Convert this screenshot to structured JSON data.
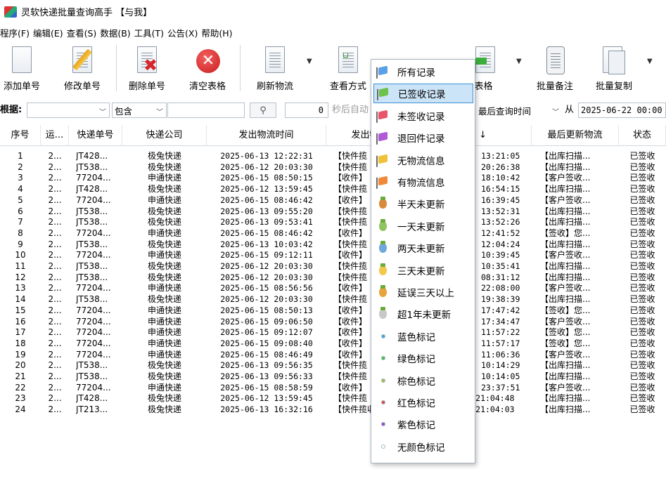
{
  "window": {
    "title": "灵软快递批量查询高手 【与我】"
  },
  "menu": [
    "程序(F)",
    "编辑(E)",
    "查看(S)",
    "数据(B)",
    "工具(T)",
    "公告(X)",
    "帮助(H)"
  ],
  "toolbar": {
    "add": "添加单号",
    "edit": "修改单号",
    "delete": "删除单号",
    "clear": "清空表格",
    "refresh": "刷新物流",
    "view_mode": "查看方式",
    "export": "出表格",
    "batch_note": "批量备注",
    "batch_copy": "批量复制"
  },
  "filter": {
    "label": "根据:",
    "field_value": "",
    "match_mode": "包含",
    "keyword": "",
    "interval": "0",
    "auto_label": "秒后自动",
    "time_field": "最后查询时间",
    "from_label": "从",
    "from_date": "2025-06-22 00:00"
  },
  "table": {
    "columns": [
      "序号",
      "运...",
      "快递单号",
      "快递公司",
      "发出物流时间",
      "发出物流",
      "时间 ↓",
      "最后更新物流",
      "状态"
    ],
    "rows": [
      [
        "1",
        "2...",
        "JT428...",
        "极兔快递",
        "2025-06-13 12:22:31",
        "【快件揽",
        "13:21:05",
        "【出库扫描...",
        "已签收"
      ],
      [
        "2",
        "2...",
        "JT538...",
        "极兔快递",
        "2025-06-12 20:03:30",
        "【快件揽",
        "20:26:38",
        "【出库扫描...",
        "已签收"
      ],
      [
        "3",
        "2...",
        "77204...",
        "申通快递",
        "2025-06-15 08:50:15",
        "【收件】",
        "18:10:42",
        "【客户签收...",
        "已签收"
      ],
      [
        "4",
        "2...",
        "JT428...",
        "极兔快递",
        "2025-06-12 13:59:45",
        "【快件揽",
        "16:54:15",
        "【出库扫描...",
        "已签收"
      ],
      [
        "5",
        "2...",
        "77204...",
        "申通快递",
        "2025-06-15 08:46:42",
        "【收件】",
        "16:39:45",
        "【客户签收...",
        "已签收"
      ],
      [
        "6",
        "2...",
        "JT538...",
        "极兔快递",
        "2025-06-13 09:55:20",
        "【快件揽",
        "13:52:31",
        "【出库扫描...",
        "已签收"
      ],
      [
        "7",
        "2...",
        "JT538...",
        "极兔快递",
        "2025-06-13 09:53:41",
        "【快件揽",
        "13:52:26",
        "【出库扫描...",
        "已签收"
      ],
      [
        "8",
        "2...",
        "77204...",
        "申通快递",
        "2025-06-15 08:46:42",
        "【收件】",
        "12:41:52",
        "【签收】您...",
        "已签收"
      ],
      [
        "9",
        "2...",
        "JT538...",
        "极兔快递",
        "2025-06-13 10:03:42",
        "【快件揽",
        "12:04:24",
        "【出库扫描...",
        "已签收"
      ],
      [
        "10",
        "2...",
        "77204...",
        "申通快递",
        "2025-06-15 09:12:11",
        "【收件】",
        "10:39:45",
        "【客户签收...",
        "已签收"
      ],
      [
        "11",
        "2...",
        "JT538...",
        "极兔快递",
        "2025-06-12 20:03:30",
        "【快件揽",
        "10:35:41",
        "【出库扫描...",
        "已签收"
      ],
      [
        "12",
        "2...",
        "JT538...",
        "极兔快递",
        "2025-06-12 20:03:30",
        "【快件揽",
        "08:31:12",
        "【出库扫描...",
        "已签收"
      ],
      [
        "13",
        "2...",
        "77204...",
        "申通快递",
        "2025-06-15 08:56:56",
        "【收件】",
        "22:08:00",
        "【客户签收...",
        "已签收"
      ],
      [
        "14",
        "2...",
        "JT538...",
        "极兔快递",
        "2025-06-12 20:03:30",
        "【快件揽",
        "19:38:39",
        "【出库扫描...",
        "已签收"
      ],
      [
        "15",
        "2...",
        "77204...",
        "申通快递",
        "2025-06-15 08:50:13",
        "【收件】",
        "17:47:42",
        "【签收】您...",
        "已签收"
      ],
      [
        "16",
        "2...",
        "77204...",
        "申通快递",
        "2025-06-15 09:06:50",
        "【收件】",
        "17:34:47",
        "【客户签收...",
        "已签收"
      ],
      [
        "17",
        "2...",
        "77204...",
        "申通快递",
        "2025-06-15 09:12:07",
        "【收件】",
        "11:57:22",
        "【签收】您...",
        "已签收"
      ],
      [
        "18",
        "2...",
        "77204...",
        "申通快递",
        "2025-06-15 09:08:40",
        "【收件】",
        "11:57:17",
        "【签收】您...",
        "已签收"
      ],
      [
        "19",
        "2...",
        "77204...",
        "申通快递",
        "2025-06-15 08:46:49",
        "【收件】",
        "11:06:36",
        "【客户签收...",
        "已签收"
      ],
      [
        "20",
        "2...",
        "JT538...",
        "极兔快递",
        "2025-06-13 09:56:35",
        "【快件揽",
        "10:14:29",
        "【出库扫描...",
        "已签收"
      ],
      [
        "21",
        "2...",
        "JT538...",
        "极兔快递",
        "2025-06-13 09:56:33",
        "【快件揽",
        "10:14:05",
        "【出库扫描...",
        "已签收"
      ],
      [
        "22",
        "2...",
        "77204...",
        "申通快递",
        "2025-06-15 08:58:59",
        "【收件】",
        "23:37:51",
        "【客户签收...",
        "已签收"
      ],
      [
        "23",
        "2...",
        "JT428...",
        "极兔快递",
        "2025-06-12 13:59:45",
        "【快件揽",
        "2025-06-17 21:04:48",
        "【出库扫描...",
        "已签收"
      ],
      [
        "24",
        "2...",
        "JT213...",
        "极兔快递",
        "2025-06-13 16:32:16",
        "【快件揽收",
        "2025-06-17 21:04:03",
        "【出库扫描...",
        "已签收"
      ]
    ]
  },
  "popup_menu": {
    "items": [
      {
        "label": "所有记录",
        "icon": "flag-icon",
        "color": "#5aa0e6"
      },
      {
        "label": "已签收记录",
        "icon": "flag-icon",
        "color": "#6cc24a",
        "selected": true
      },
      {
        "label": "未签收记录",
        "icon": "flag-icon",
        "color": "#e8556a"
      },
      {
        "label": "退回件记录",
        "icon": "flag-icon",
        "color": "#b05ad8"
      },
      {
        "label": "无物流信息",
        "icon": "flag-icon",
        "color": "#f0c23a"
      },
      {
        "label": "有物流信息",
        "icon": "flag-icon",
        "color": "#f08a3a"
      },
      {
        "label": "半天未更新",
        "icon": "medal-icon",
        "color": "#d98a3c"
      },
      {
        "label": "一天未更新",
        "icon": "medal-icon",
        "color": "#8fc460"
      },
      {
        "label": "两天未更新",
        "icon": "medal-icon",
        "color": "#6fa8dc"
      },
      {
        "label": "三天未更新",
        "icon": "medal-icon",
        "color": "#f2c94c"
      },
      {
        "label": "延误三天以上",
        "icon": "medal-icon",
        "color": "#e8a43c"
      },
      {
        "label": "超1年未更新",
        "icon": "medal-icon",
        "color": "#c9c9c9"
      },
      {
        "label": "蓝色标记",
        "icon": "dot-icon",
        "color": "#4aa3df"
      },
      {
        "label": "绿色标记",
        "icon": "dot-icon",
        "color": "#4cbf4c"
      },
      {
        "label": "棕色标记",
        "icon": "dot-icon",
        "color": "#a8b94a"
      },
      {
        "label": "红色标记",
        "icon": "dot-icon",
        "color": "#e04a4a"
      },
      {
        "label": "紫色标记",
        "icon": "dot-icon",
        "color": "#9b4ad0"
      },
      {
        "label": "无颜色标记",
        "icon": "dot-icon",
        "color": "#ffffff"
      }
    ]
  }
}
